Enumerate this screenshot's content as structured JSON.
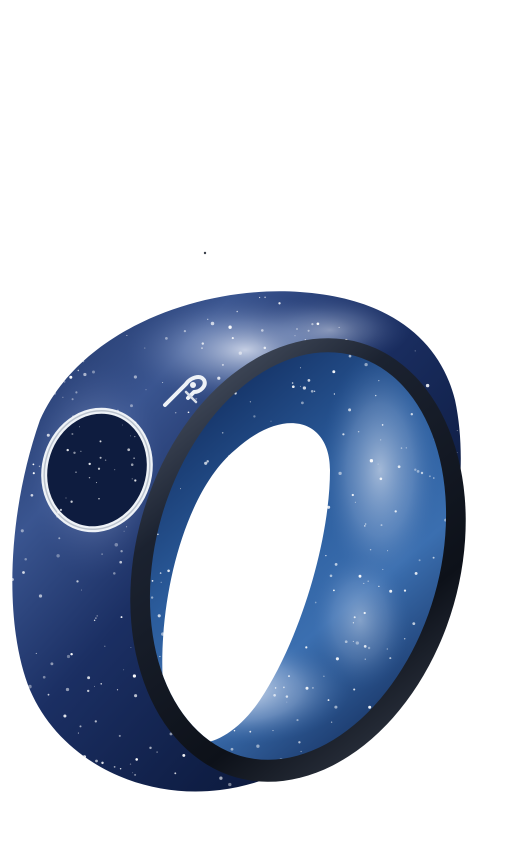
{
  "image": {
    "subject": "",
    "colors": {
      "background": "#ffffff",
      "band_dark": "#0c1a3a",
      "band_mid": "#1f3d7a",
      "band_light": "#c9d4ea",
      "inner_blue": "#2a5d9c",
      "inner_deep": "#0a1f4a",
      "rim_dark": "#141a26",
      "silver": "#e8ecf2"
    },
    "icons": [
      "ring-icon",
      "silver-circle-inlay-icon",
      "silver-star-inlay-icon"
    ]
  }
}
